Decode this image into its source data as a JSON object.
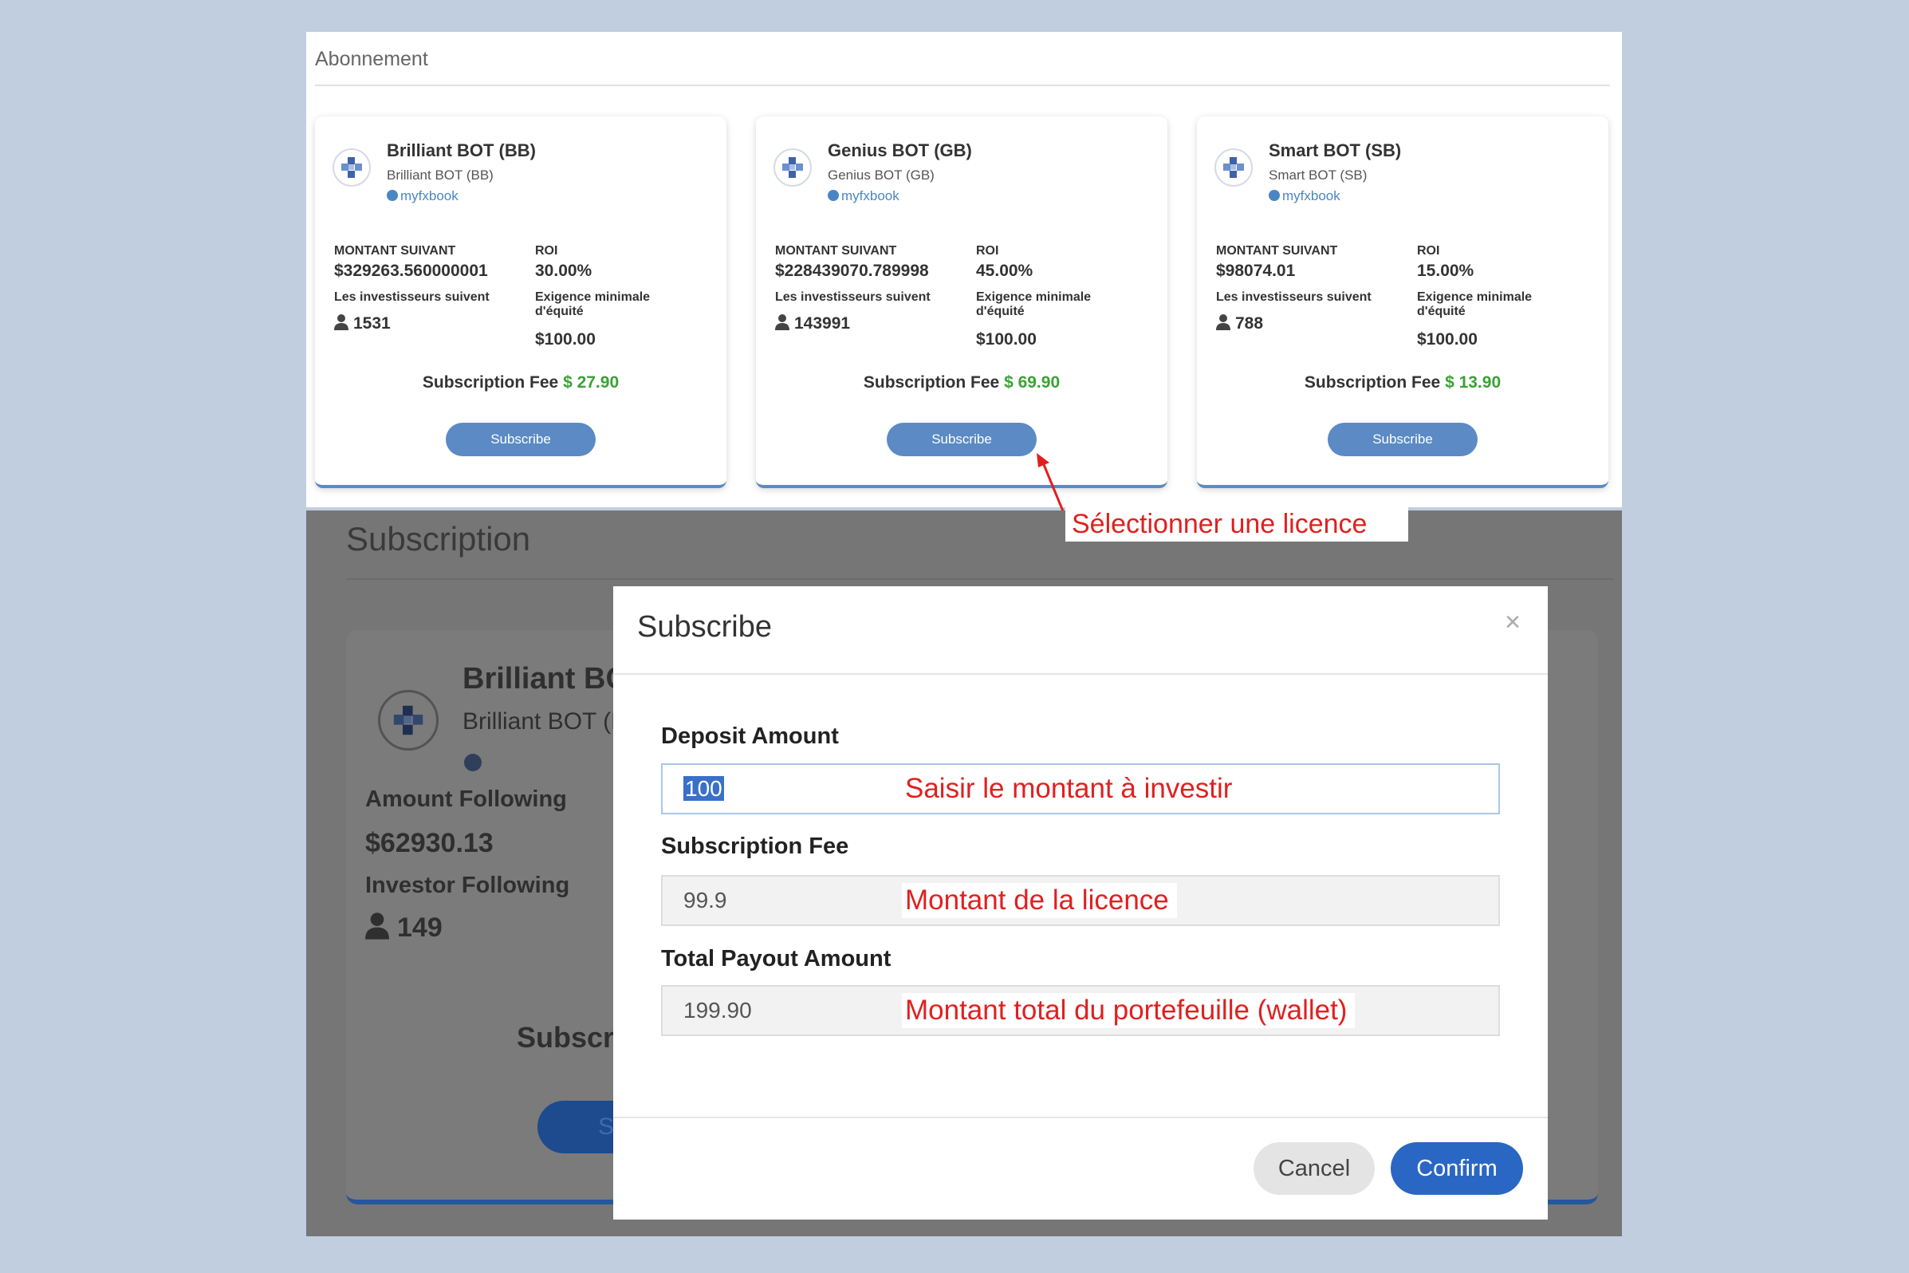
{
  "subscriptions_page": {
    "title": "Abonnement",
    "cards": [
      {
        "name": "Brilliant BOT (BB)",
        "subname": "Brilliant BOT (BB)",
        "link": "myfxbook",
        "amount_label": "MONTANT SUIVANT",
        "amount": "$329263.560000001",
        "roi_label": "ROI",
        "roi": "30.00%",
        "investors_label": "Les investisseurs suivent",
        "investors": "1531",
        "equity_label_1": "Exigence minimale",
        "equity_label_2": "d'équité",
        "equity": "$100.00",
        "fee_label": "Subscription Fee",
        "fee": "$ 27.90",
        "button": "Subscribe"
      },
      {
        "name": "Genius BOT (GB)",
        "subname": "Genius BOT (GB)",
        "link": "myfxbook",
        "amount_label": "MONTANT SUIVANT",
        "amount": "$228439070.789998",
        "roi_label": "ROI",
        "roi": "45.00%",
        "investors_label": "Les investisseurs suivent",
        "investors": "143991",
        "equity_label_1": "Exigence minimale",
        "equity_label_2": "d'équité",
        "equity": "$100.00",
        "fee_label": "Subscription Fee",
        "fee": "$ 69.90",
        "button": "Subscribe"
      },
      {
        "name": "Smart BOT (SB)",
        "subname": "Smart BOT (SB)",
        "link": "myfxbook",
        "amount_label": "MONTANT SUIVANT",
        "amount": "$98074.01",
        "roi_label": "ROI",
        "roi": "15.00%",
        "investors_label": "Les investisseurs suivent",
        "investors": "788",
        "equity_label_1": "Exigence minimale",
        "equity_label_2": "d'équité",
        "equity": "$100.00",
        "fee_label": "Subscription Fee",
        "fee": "$ 13.90",
        "button": "Subscribe"
      }
    ]
  },
  "annotations": {
    "select_license": "Sélectionner une licence",
    "enter_amount": "Saisir le montant à investir",
    "license_amount": "Montant de la licence",
    "wallet_total": "Montant total du portefeuille (wallet)"
  },
  "background_page": {
    "title": "Subscription",
    "card_name": "Brilliant BC",
    "card_sub": "Brilliant BOT (E",
    "amount_label": "Amount Following",
    "amount": "$62930.13",
    "investor_label": "Investor Following",
    "investors": "149",
    "fee_label": "Subscript",
    "button": "S"
  },
  "modal": {
    "title": "Subscribe",
    "close": "×",
    "deposit_label": "Deposit Amount",
    "deposit_value": "100",
    "fee_label": "Subscription Fee",
    "fee_value": "99.9",
    "total_label": "Total Payout Amount",
    "total_value": "199.90",
    "cancel": "Cancel",
    "confirm": "Confirm"
  },
  "colors": {
    "accent_blue": "#5b8ac4",
    "fee_green": "#3aa235",
    "annotation_red": "#e02020",
    "confirm_blue": "#2a67c4"
  }
}
